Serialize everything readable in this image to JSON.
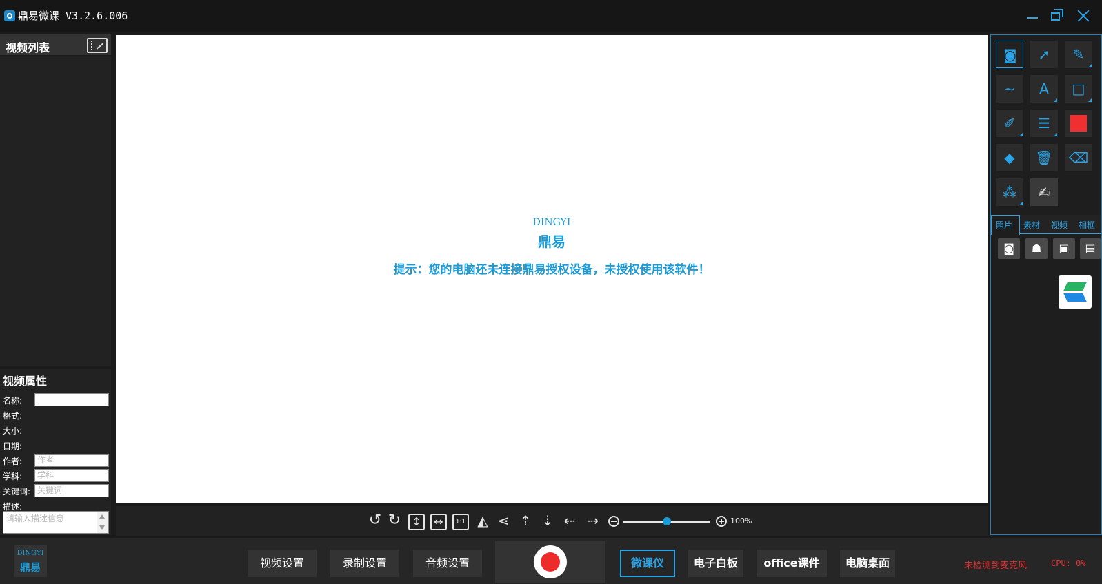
{
  "app": {
    "title": "鼎易微课 V3.2.6.006"
  },
  "video_list": {
    "title": "视频列表",
    "icon": "film-edit-icon"
  },
  "properties": {
    "title": "视频属性",
    "name_label": "名称:",
    "name_value": "",
    "format_label": "格式:",
    "size_label": "大小:",
    "date_label": "日期:",
    "author_label": "作者:",
    "author_placeholder": "作者",
    "subject_label": "学科:",
    "subject_placeholder": "学科",
    "keywords_label": "关键词:",
    "keywords_placeholder": "关键词",
    "description_label": "描述:",
    "description_placeholder": "请输入描述信息"
  },
  "canvas": {
    "brand_en": "DINGYI",
    "brand_cn": "鼎易",
    "notice": "提示：您的电脑还未连接鼎易授权设备，未授权使用该软件！"
  },
  "canvas_toolbar": {
    "zoom_level": "100%",
    "zoom_fraction": 0.5
  },
  "tools": {
    "color_value": "#f03030",
    "text_tool_label": "A"
  },
  "right_tabs": [
    "照片",
    "素材",
    "视频",
    "相框"
  ],
  "bottom": {
    "logo_en": "DINGYI",
    "logo_cn": "鼎易",
    "settings_buttons": [
      "视频设置",
      "录制设置",
      "音频设置"
    ],
    "mode_buttons": [
      "微课仪",
      "电子白板",
      "office课件",
      "电脑桌面"
    ],
    "mic_status": "未检测到麦克风",
    "cpu_status": "CPU:  0%"
  },
  "colors": {
    "accent": "#29a3e6",
    "record": "#ee2b2b",
    "warning": "#e23030"
  }
}
